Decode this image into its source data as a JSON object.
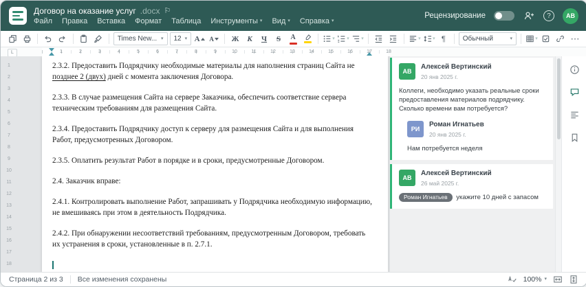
{
  "header": {
    "document_name": "Договор на оказание услуг",
    "document_ext": ".docx",
    "menus": [
      "Файл",
      "Правка",
      "Вставка",
      "Формат",
      "Таблица",
      "Инструменты",
      "Вид",
      "Справка"
    ],
    "review_label": "Рецензирование",
    "avatar_initials": "АВ"
  },
  "icons": {
    "chevron": "▾",
    "flag": "⚐",
    "help": "?",
    "more": "⋯",
    "pilcrow": "¶",
    "tab_selector": "L",
    "font_letter": "А"
  },
  "toolbar": {
    "font_family": "Times New...",
    "font_size": "12",
    "bold": "Ж",
    "italic": "К",
    "underline": "Ч",
    "strikethrough": "S",
    "font_color_letter": "А",
    "style_name": "Обычный"
  },
  "ruler": {
    "horizontal": [
      "1",
      "2",
      "3",
      "4",
      "5",
      "6",
      "7",
      "8",
      "9",
      "10",
      "11",
      "12",
      "13",
      "14",
      "15",
      "16",
      "17",
      "18"
    ],
    "vertical": [
      "1",
      "2",
      "3",
      "4",
      "5",
      "6",
      "7",
      "8",
      "9",
      "10",
      "11",
      "12",
      "13",
      "14",
      "15",
      "16",
      "17",
      "18"
    ]
  },
  "document": {
    "paragraphs": [
      {
        "pre": "2.3.2. Предоставить Подрядчику необходимые материалы для наполнения страниц Сайта не ",
        "commented": "позднее 2 (двух)",
        "post": " дней с момента заключения Договора."
      },
      {
        "text": "2.3.3. В случае размещения Сайта на сервере Заказчика, обеспечить соответствие сервера техническим требованиям для размещения Сайта."
      },
      {
        "text": "2.3.4. Предоставить Подрядчику доступ к серверу для размещения Сайта и для выполнения Работ, предусмотренных Договором."
      },
      {
        "text": "2.3.5. Оплатить результат Работ в порядке и в сроки, предусмотренные Договором."
      },
      {
        "text": "2.4. Заказчик вправе:"
      },
      {
        "text": "2.4.1. Контролировать выполнение Работ, запрашивать у Подрядчика необходимую информацию, не вмешиваясь при этом в деятельность Подрядчика."
      },
      {
        "text": "2.4.2. При обнаружении несоответствий требованиям, предусмотренным Договором, требовать их устранения в сроки, установленные в п. 2.7.1."
      }
    ]
  },
  "comments": {
    "thread1": {
      "author": "Алексей Вертинский",
      "initials": "АВ",
      "date": "20 янв 2025 г.",
      "text": "Коллеги, необходимо указать реальные сроки предоставления материалов подрядчику. Сколько времени вам потребуется?",
      "reply": {
        "author": "Роман Игнатьев",
        "initials": "РИ",
        "date": "20 янв 2025 г.",
        "text": "Нам потребуется неделя"
      }
    },
    "thread2": {
      "author": "Алексей Вертинский",
      "initials": "АВ",
      "date": "26 май 2025 г.",
      "mention": "Роман Игнатьев",
      "text": " укажите 10 дней с запасом"
    }
  },
  "statusbar": {
    "page": "Страница 2 из 3",
    "saved": "Все изменения сохранены",
    "zoom": "100%"
  },
  "colors": {
    "header_bg": "#2e5a55",
    "comment_green": "#2fb577",
    "avatar_green": "#34a765",
    "avatar_blue": "#7e96cc",
    "mention_bg": "#6a7076",
    "highlight_yellow": "#ffd500",
    "font_color_red": "#d93025",
    "ruler_marker": "#4898a8"
  }
}
